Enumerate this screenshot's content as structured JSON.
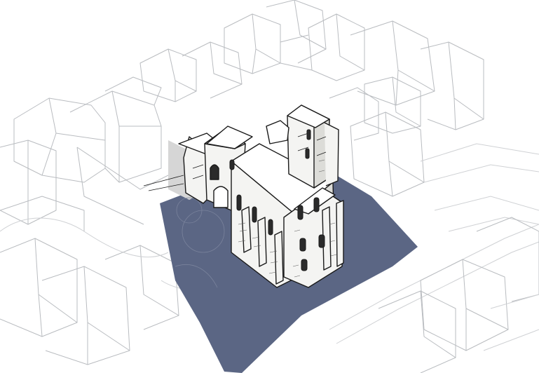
{
  "scene": {
    "colors": {
      "background": "#ffffff",
      "shadow": "#5b6684",
      "context_lines": "#b9bcc0",
      "ink": "#1a1a1a",
      "grey_shadow": "#d6d6d6"
    },
    "subject": "church-sketch",
    "context": "surrounding-buildings-wireframe"
  }
}
